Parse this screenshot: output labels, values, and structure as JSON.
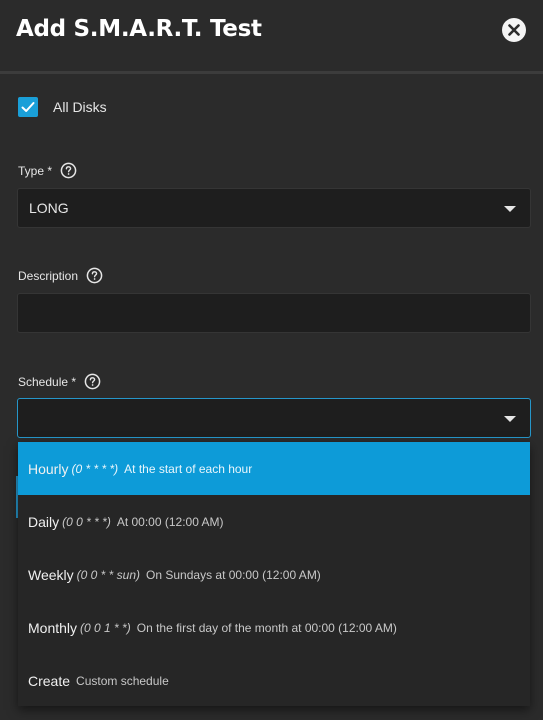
{
  "header": {
    "title": "Add S.M.A.R.T. Test"
  },
  "all_disks": {
    "label": "All Disks",
    "checked": true
  },
  "type_field": {
    "label": "Type *",
    "value": "LONG"
  },
  "description_field": {
    "label": "Description",
    "value": ""
  },
  "schedule_field": {
    "label": "Schedule *",
    "value": "",
    "options": [
      {
        "name": "Hourly",
        "cron": "(0 * * * *)",
        "description": "At the start of each hour",
        "highlighted": true
      },
      {
        "name": "Daily",
        "cron": "(0 0 * * *)",
        "description": "At 00:00 (12:00 AM)",
        "highlighted": false
      },
      {
        "name": "Weekly",
        "cron": "(0 0 * * sun)",
        "description": "On Sundays at 00:00 (12:00 AM)",
        "highlighted": false
      },
      {
        "name": "Monthly",
        "cron": "(0 0 1 * *)",
        "description": "On the first day of the month at 00:00 (12:00 AM)",
        "highlighted": false
      },
      {
        "name": "Create",
        "cron": "",
        "description": "Custom schedule",
        "highlighted": false
      }
    ]
  },
  "colors": {
    "accent": "#0d9bd8",
    "background": "#2b2b2b",
    "input_bg": "#1e1e1e"
  },
  "icons": {
    "close": "close-icon",
    "help": "help-circle-icon",
    "check": "check-icon",
    "dropdown": "chevron-down-icon"
  }
}
